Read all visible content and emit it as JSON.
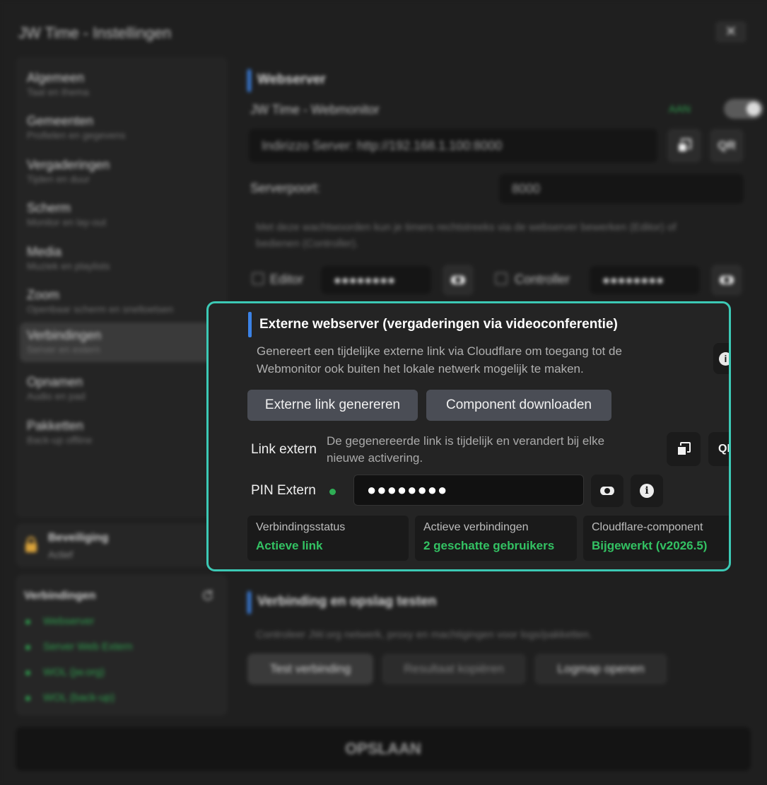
{
  "window": {
    "title": "JW Time - Instellingen",
    "close_glyph": "✕"
  },
  "sidebar": {
    "items": [
      {
        "label": "Algemeen",
        "sub": "Taal en thema"
      },
      {
        "label": "Gemeenten",
        "sub": "Profielen en gegevens"
      },
      {
        "label": "Vergaderingen",
        "sub": "Tijden en duur"
      },
      {
        "label": "Scherm",
        "sub": "Monitor en lay-out"
      },
      {
        "label": "Media",
        "sub": "Muziek en playlists"
      },
      {
        "label": "Zoom",
        "sub": "Openbaar scherm en sneltoetsen"
      },
      {
        "label": "Verbindingen",
        "sub": "Server en extern"
      },
      {
        "label": "Opnamen",
        "sub": "Audio en pad"
      },
      {
        "label": "Pakketten",
        "sub": "Back-up offline"
      }
    ],
    "active_index": 6
  },
  "security": {
    "title": "Beveiliging",
    "status": "Actief"
  },
  "connections": {
    "title": "Verbindingen",
    "items": [
      "Webserver",
      "Server Web Extern",
      "WOL (jw.org)",
      "WOL (back-up)"
    ],
    "status_color": "#2e9d4d"
  },
  "webserver": {
    "heading": "Webserver",
    "monitor_label": "JW Time - Webmonitor",
    "toggle_state": "AAN",
    "address": "Indirizzo Server: http://192.168.1.100:8000",
    "qr_label": "QR",
    "port_label": "Serverpoort:",
    "port_value": "8000",
    "password_note": "Met deze wachtwoorden kun je timers rechtstreeks via de webserver bewerken (Editor) of bedienen (Controller).",
    "editor_label": "Editor",
    "editor_password": "●●●●●●●●",
    "controller_label": "Controller",
    "controller_password": "●●●●●●●●"
  },
  "external": {
    "heading": "Externe webserver (vergaderingen via videoconferentie)",
    "description": "Genereert een tijdelijke externe link via Cloudflare om toegang tot de Webmonitor ook buiten het lokale netwerk mogelijk te maken.",
    "generate_button": "Externe link genereren",
    "download_button": "Component downloaden",
    "link_label": "Link extern",
    "link_note": "De gegenereerde link is tijdelijk en verandert bij elke nieuwe activering.",
    "qr_label": "QR",
    "pin_label": "PIN Extern",
    "pin_value": "●●●●●●●●",
    "info_glyph": "i",
    "stats": [
      {
        "label": "Verbindingsstatus",
        "value": "Actieve link"
      },
      {
        "label": "Actieve verbindingen",
        "value": "2 geschatte gebruikers"
      },
      {
        "label": "Cloudflare-component",
        "value": "Bijgewerkt (v2026.5)"
      }
    ],
    "accent_color": "#3cc9b5",
    "status_color": "#33c263"
  },
  "test": {
    "heading": "Verbinding en opslag testen",
    "description": "Controleer JW.org netwerk, proxy en machtigingen voor logs/pakketten.",
    "test_button": "Test verbinding",
    "copy_button": "Resultaat kopiëren",
    "logs_button": "Logmap openen"
  },
  "save_button": "OPSLAAN"
}
